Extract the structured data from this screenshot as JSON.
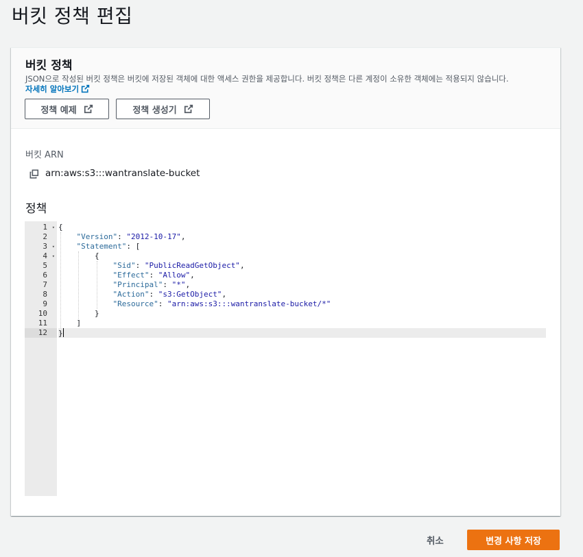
{
  "page": {
    "title": "버킷 정책 편집"
  },
  "panel": {
    "title": "버킷 정책",
    "description": "JSON으로 작성된 버킷 정책은 버킷에 저장된 객체에 대한 액세스 권한을 제공합니다. 버킷 정책은 다른 계정이 소유한 객체에는 적용되지 않습니다.",
    "learn_more": "자세히 알아보기",
    "buttons": {
      "examples": "정책 예제",
      "generator": "정책 생성기"
    }
  },
  "arn": {
    "label": "버킷 ARN",
    "value": "arn:aws:s3:::wantranslate-bucket"
  },
  "policy": {
    "label": "정책",
    "lines": [
      {
        "n": "1",
        "fold": true,
        "text": "{"
      },
      {
        "n": "2",
        "fold": false,
        "key": "\"Version\"",
        "sep": ": ",
        "val": "\"2012-10-17\"",
        "end": ",",
        "indent": 1
      },
      {
        "n": "3",
        "fold": true,
        "key": "\"Statement\"",
        "sep": ": ",
        "val": "",
        "end": "[",
        "indent": 1
      },
      {
        "n": "4",
        "fold": true,
        "text": "{",
        "indent": 2
      },
      {
        "n": "5",
        "fold": false,
        "key": "\"Sid\"",
        "sep": ": ",
        "val": "\"PublicReadGetObject\"",
        "end": ",",
        "indent": 3
      },
      {
        "n": "6",
        "fold": false,
        "key": "\"Effect\"",
        "sep": ": ",
        "val": "\"Allow\"",
        "end": ",",
        "indent": 3
      },
      {
        "n": "7",
        "fold": false,
        "key": "\"Principal\"",
        "sep": ": ",
        "val": "\"*\"",
        "end": ",",
        "indent": 3
      },
      {
        "n": "8",
        "fold": false,
        "key": "\"Action\"",
        "sep": ": ",
        "val": "\"s3:GetObject\"",
        "end": ",",
        "indent": 3
      },
      {
        "n": "9",
        "fold": false,
        "key": "\"Resource\"",
        "sep": ": ",
        "val": "\"arn:aws:s3:::wantranslate-bucket/*\"",
        "end": "",
        "indent": 3
      },
      {
        "n": "10",
        "fold": false,
        "text": "}",
        "indent": 2
      },
      {
        "n": "11",
        "fold": false,
        "text": "]",
        "indent": 1
      },
      {
        "n": "12",
        "fold": false,
        "text": "}",
        "active": true
      }
    ]
  },
  "footer": {
    "cancel": "취소",
    "save": "변경 사항 저장"
  },
  "colors": {
    "accent": "#ec7211",
    "link": "#0073bb",
    "json_key": "#2c6a9a",
    "json_string": "#1a1aa6"
  }
}
